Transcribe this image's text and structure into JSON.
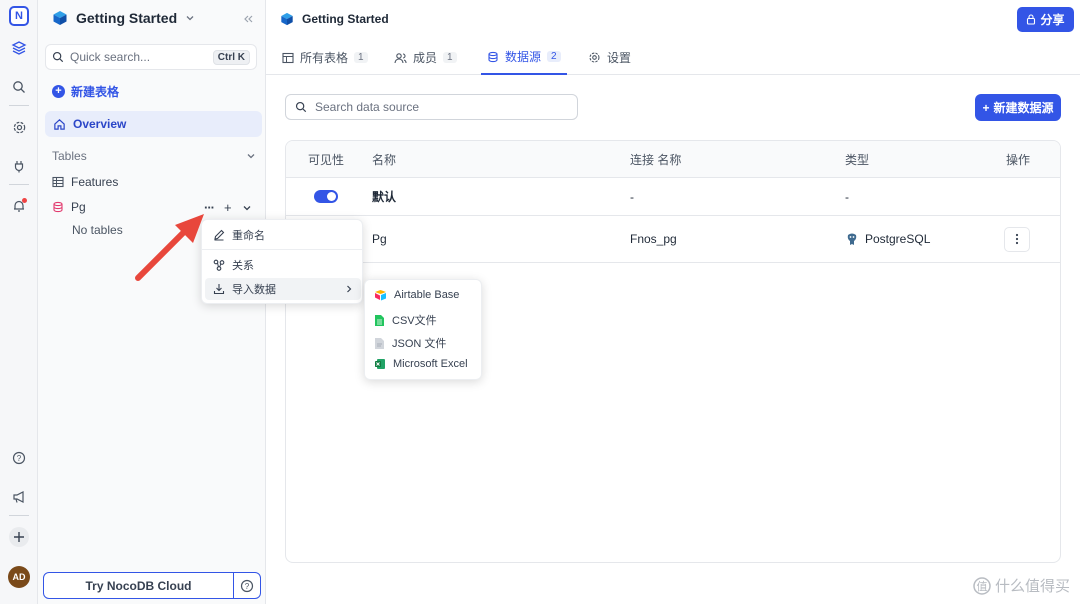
{
  "rail": {
    "logo_letter": "N",
    "avatar_initials": "AD",
    "icons": [
      "nocodb-logo-icon",
      "stack-icon",
      "search-icon",
      "settings-icon",
      "plug-icon",
      "bell-icon",
      "help-icon",
      "megaphone-icon",
      "plus-icon"
    ]
  },
  "sidebar": {
    "project_title": "Getting Started",
    "search_placeholder": "Quick search...",
    "search_shortcut": "Ctrl K",
    "new_table": "新建表格",
    "overview": "Overview",
    "tables_header": "Tables",
    "items": [
      {
        "label": "Features"
      },
      {
        "label": "Pg"
      }
    ],
    "no_tables": "No tables",
    "try_cloud": "Try NocoDB Cloud"
  },
  "context_menu": {
    "items": [
      {
        "label": "重命名"
      },
      {
        "label": "关系"
      },
      {
        "label": "导入数据"
      }
    ],
    "submenu": [
      {
        "label": "Airtable Base"
      },
      {
        "label": "CSV文件"
      },
      {
        "label": "JSON 文件"
      },
      {
        "label": "Microsoft Excel"
      }
    ]
  },
  "header": {
    "title": "Getting Started",
    "share": "分享"
  },
  "tabs": [
    {
      "label": "所有表格",
      "count": "1"
    },
    {
      "label": "成员",
      "count": "1"
    },
    {
      "label": "数据源",
      "count": "2"
    },
    {
      "label": "设置",
      "count": ""
    }
  ],
  "datasource": {
    "search_placeholder": "Search data source",
    "new_button": "新建数据源",
    "columns": [
      "可见性",
      "名称",
      "连接 名称",
      "类型",
      "操作"
    ],
    "rows": [
      {
        "name": "默认",
        "connection": "-",
        "type": "-"
      },
      {
        "name": "Pg",
        "connection": "Fnos_pg",
        "type": "PostgreSQL"
      }
    ]
  },
  "watermark": "什么值得买",
  "colors": {
    "accent": "#3355e6",
    "arrow": "#e8473c"
  }
}
